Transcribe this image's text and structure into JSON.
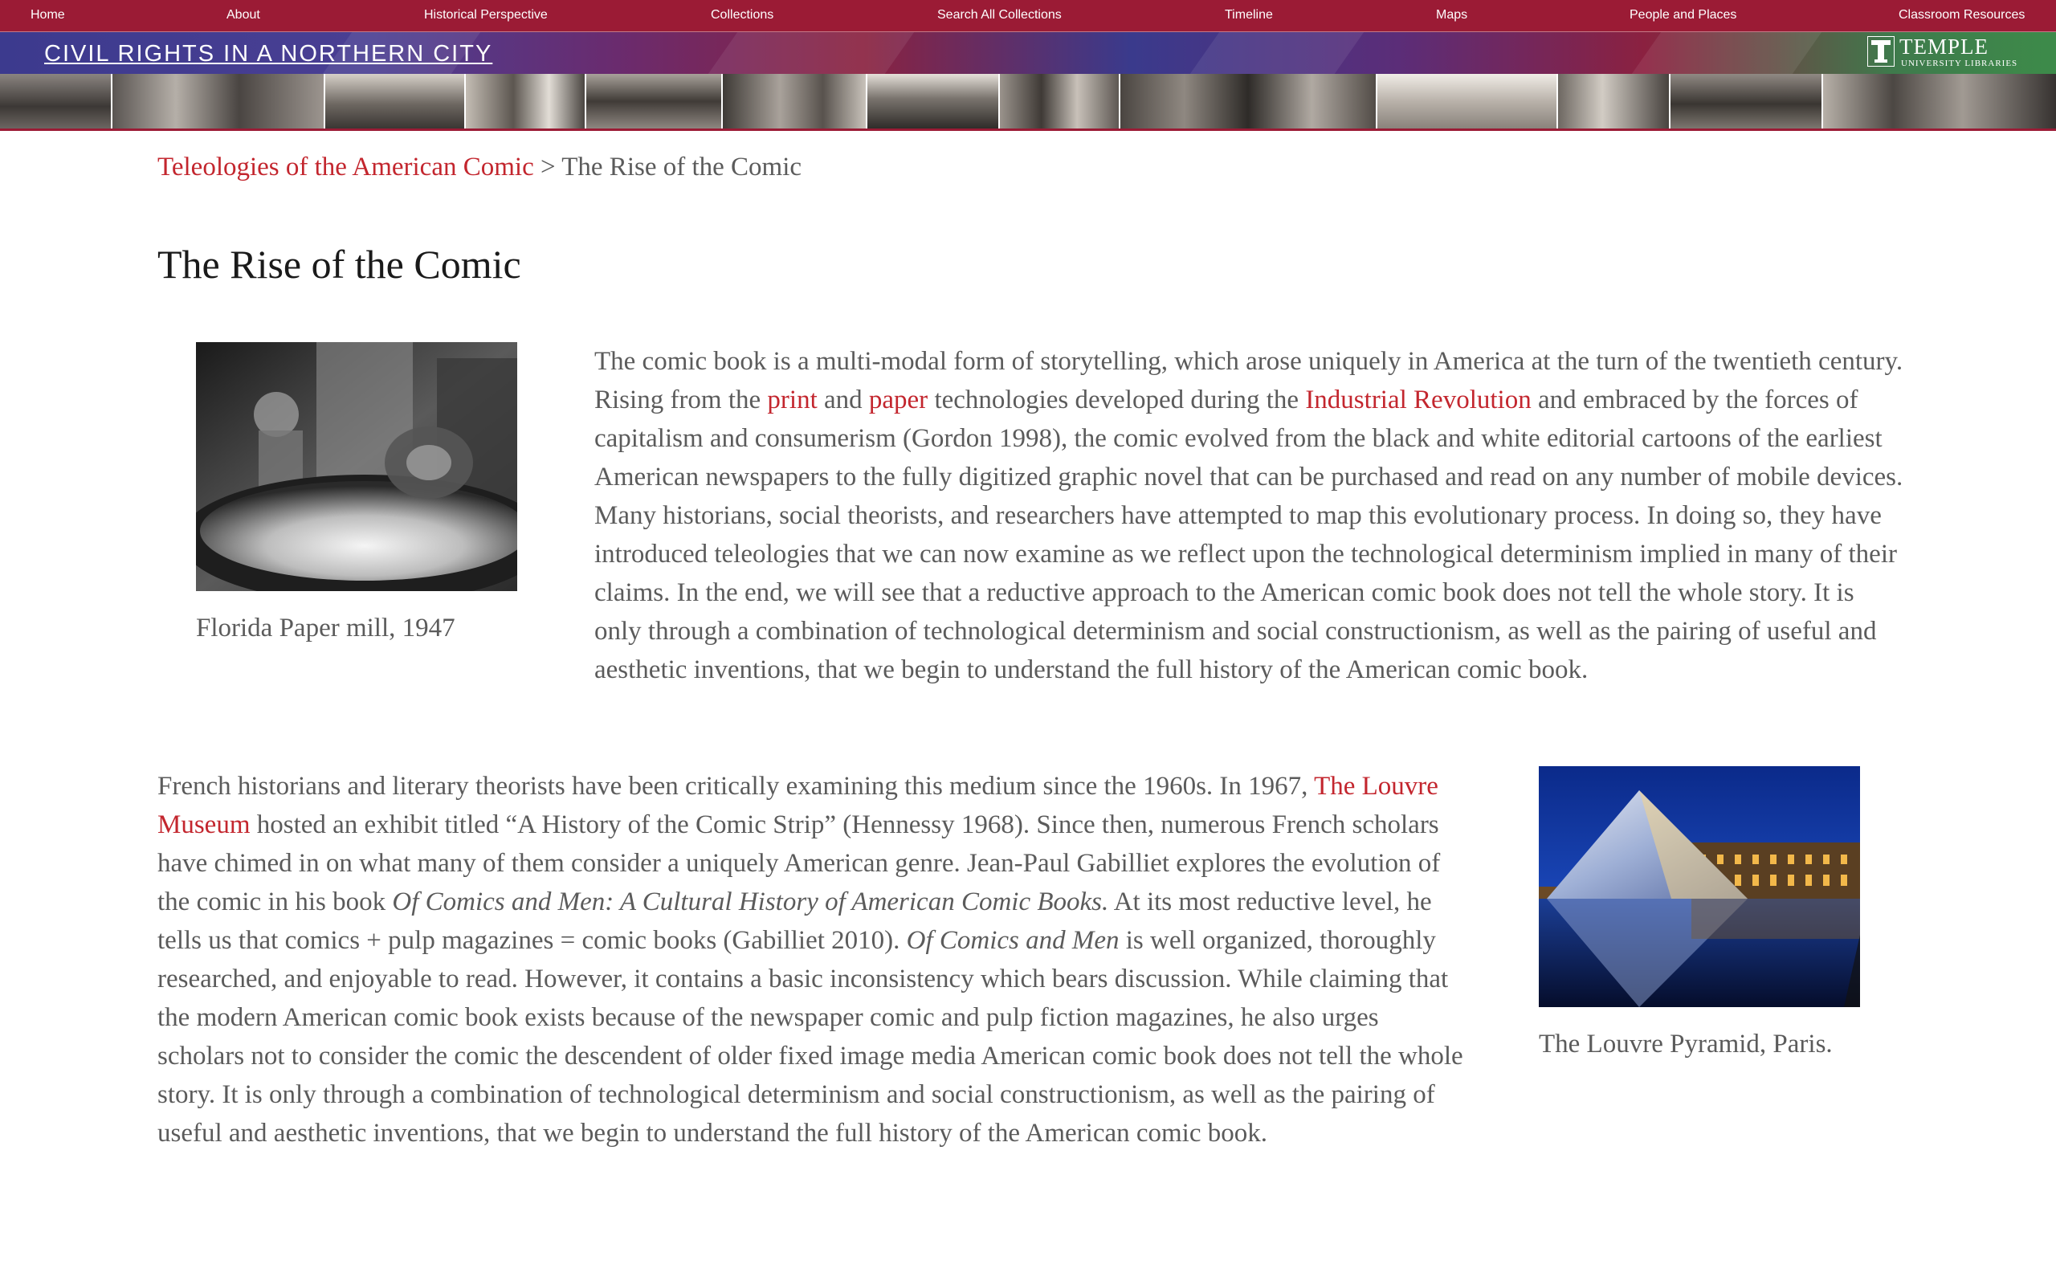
{
  "nav": {
    "items": [
      {
        "label": "Home"
      },
      {
        "label": "About"
      },
      {
        "label": "Historical Perspective"
      },
      {
        "label": "Collections"
      },
      {
        "label": "Search All Collections"
      },
      {
        "label": "Timeline"
      },
      {
        "label": "Maps"
      },
      {
        "label": "People and Places"
      },
      {
        "label": "Classroom Resources"
      }
    ]
  },
  "banner": {
    "title": "CIVIL RIGHTS IN A NORTHERN CITY",
    "logo_name": "TEMPLE",
    "logo_sub": "UNIVERSITY LIBRARIES"
  },
  "breadcrumb": {
    "parent": "Teleologies of the American Comic",
    "separator": " > ",
    "current": "The Rise of the Comic"
  },
  "page": {
    "title": "The Rise of the Comic"
  },
  "figures": {
    "paper_mill": {
      "caption": "Florida Paper mill, 1947",
      "icon": "paper-mill-photo"
    },
    "louvre": {
      "caption": "The Louvre Pyramid, Paris.",
      "icon": "louvre-pyramid-photo"
    }
  },
  "para1": {
    "t1": "The comic book is a multi-modal form of storytelling, which arose uniquely in America at the turn of the twentieth century. Rising from the ",
    "link_print": "print",
    "t2": " and ",
    "link_paper": "paper",
    "t3": " technologies developed during the ",
    "link_industrial": "Industrial Revolution",
    "t4": " and embraced by the forces of capitalism and consumerism (Gordon 1998), the comic evolved from the black and white editorial cartoons of the earliest American newspapers to the fully digitized graphic novel that can be purchased and read on any number of mobile devices. Many historians, social theorists, and researchers have attempted to map this evolutionary process. In doing so, they have introduced teleologies that we can now examine as we reflect upon the technological determinism implied in many of their claims. In the end, we will see that a reductive approach to the American comic book does not tell the whole story. It is only through a combination of technological determinism and social constructionism, as well as the pairing of useful and aesthetic inventions, that we begin to understand the full history of the American comic book."
  },
  "para2": {
    "t1": "French historians and literary theorists have been critically examining this medium since the 1960s. In 1967, ",
    "link_louvre": "The Louvre Museum",
    "t2": " hosted an exhibit titled “A History of the Comic Strip” (Hennessy 1968). Since then, numerous French scholars have chimed in on what many of them consider a uniquely American genre. Jean-Paul Gabilliet explores the evolution of the comic in his book ",
    "book_title": "Of Comics and Men: A Cultural History of American Comic Books.",
    "t3": " At its most reductive level, he tells us that comics + pulp magazines = comic books (Gabilliet 2010). ",
    "book_short": "Of Comics and Men",
    "t4": " is well organized, thoroughly researched, and enjoyable to read. However, it contains a basic inconsistency which bears discussion. While claiming that the modern American comic book exists because of the newspaper comic and pulp fiction magazines, he also urges scholars not to consider the comic the descendent of older fixed image media American comic book does not tell the whole story. It is only through a combination of technological determinism and social constructionism, as well as the pairing of useful and aesthetic inventions, that we begin to understand the full history of the American comic book."
  },
  "colors": {
    "nav_bg": "#9b1b35",
    "link": "#c3262e",
    "body_text": "#5b5b5b",
    "title_text": "#1a1a1a"
  }
}
